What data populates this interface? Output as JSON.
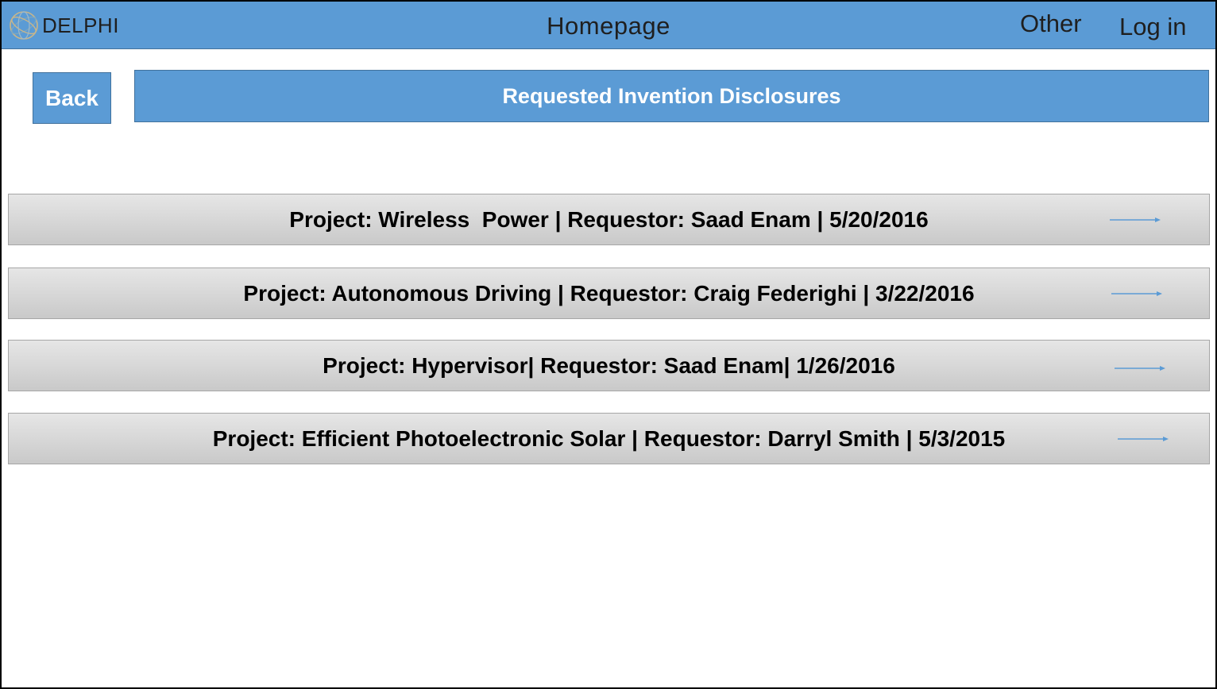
{
  "header": {
    "brand": "DELPHI",
    "title": "Homepage",
    "nav": {
      "other": "Other",
      "login": "Log in"
    }
  },
  "back_label": "Back",
  "section_title": "Requested Invention Disclosures",
  "requests": [
    {
      "text": "Project: Wireless  Power | Requestor: Saad Enam | 5/20/2016"
    },
    {
      "text": "Project: Autonomous Driving | Requestor: Craig Federighi | 3/22/2016"
    },
    {
      "text": "Project: Hypervisor| Requestor: Saad Enam| 1/26/2016"
    },
    {
      "text": "Project: Efficient Photoelectronic Solar | Requestor: Darryl Smith | 5/3/2015"
    }
  ],
  "colors": {
    "header_blue": "#5b9bd5",
    "row_gray": "#d9d9d9",
    "arrow_blue": "#5b9bd5"
  },
  "icons": {
    "logo": "globe-logo-icon",
    "row_arrow": "arrow-right-icon"
  }
}
